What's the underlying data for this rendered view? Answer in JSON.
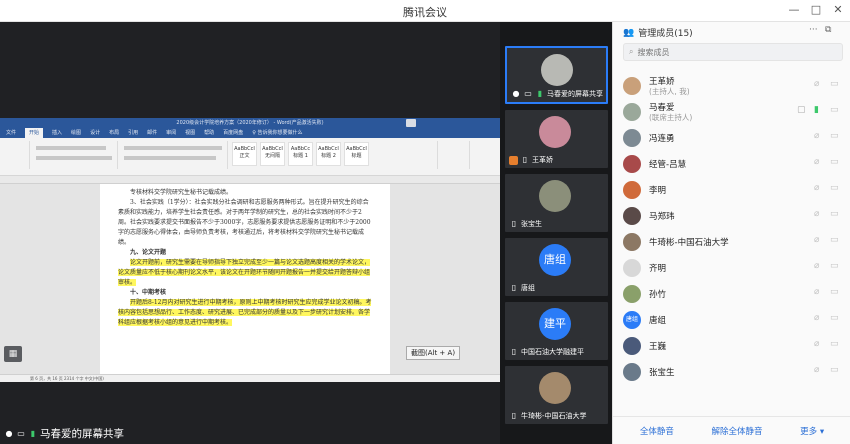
{
  "window": {
    "title": "腾讯会议",
    "controls": [
      "—",
      "□",
      "✕"
    ]
  },
  "shared_screen": {
    "sharer_label": "马春爱的屏幕共享",
    "doc_title": "2020级会计学院培养方案（2020年修订） - Word(产品激活失败)",
    "menu": [
      "文件",
      "开始",
      "插入",
      "绘图",
      "设计",
      "布局",
      "引用",
      "邮件",
      "审阅",
      "视图",
      "帮助",
      "百度网盘",
      "♀ 告诉我你想要做什么"
    ],
    "styles": [
      "AaBbCcI 正文",
      "AaBbCcI 无间隔",
      "AaBbCc 标题 1",
      "AaBbCcI 标题 2",
      "AaBbCcI 标题"
    ],
    "doc": {
      "p1": "专核材料交学院研究生秘书记载成绩。",
      "p2": "3、社会实践（1学分）：社会实践分社会调研和志愿服务两种形式。旨在提升研究生的综合素质和实践能力，培养学生社会责任感。对于两年学制的研究生，总的社会实践时间不少于2周。社会实践要求提交书面报告不少于3000字，志愿服务要求提供志愿服务证明和不少于2000字的志愿服务心得体会，由导师负责考核，考核通过后，将考核材料交学院研究生秘书记载成绩。",
      "h1": "九、论文开题",
      "p3": "论文开题前，研究生需要在导师指导下独立完成至少一篇与论文选题高度相关的学术论文，论文质量应不低于核心期刊论文水平，该论文在开题环节随同开题报告一并提交给开题答辩小组审核。",
      "h2": "十、中期考核",
      "p4": "开题后8-12月内对研究生进行中期考核，原则上中期考核时研究生应完成学业论文初稿。考核内容包括思想品行、工作态度、研究进展、已完成部分的质量以及下一步研究计划安排。各学科组应根据考核小组的意见进行中期考核。"
    },
    "status": "第 6 页，共 16 页   2314 个字   中文(中国)",
    "screenshot_tip": "截图(Alt + A)"
  },
  "videos": [
    {
      "name": "马春爱的屏幕共享",
      "kind": "photo",
      "active": true
    },
    {
      "name": "王革娇",
      "kind": "photo",
      "active": false
    },
    {
      "name": "张宝生",
      "kind": "photo",
      "active": false
    },
    {
      "name": "唐组",
      "kind": "avatar",
      "avatar_text": "唐组",
      "active": false
    },
    {
      "name": "中国石油大学融建平",
      "kind": "avatar",
      "avatar_text": "建平",
      "active": false
    },
    {
      "name": "牛琦彬-中国石油大学",
      "kind": "photo",
      "active": false
    }
  ],
  "panel": {
    "title": "管理成员(15)",
    "search_placeholder": "搜索成员",
    "members": [
      {
        "name": "王革娇",
        "sub": "(主持人, 我)",
        "avatar_color": "#c9a07a"
      },
      {
        "name": "马春爱",
        "sub": "(联席主持人)",
        "avatar_color": "#9aa89a",
        "mic_on": true,
        "screen": true
      },
      {
        "name": "冯连勇",
        "avatar_color": "#7d8a93"
      },
      {
        "name": "经管-吕慧",
        "avatar_color": "#a84a4a"
      },
      {
        "name": "李明",
        "avatar_color": "#d06a3a"
      },
      {
        "name": "马郑玮",
        "avatar_color": "#5a4a48"
      },
      {
        "name": "牛琦彬-中国石油大学",
        "avatar_color": "#8c7864"
      },
      {
        "name": "齐明",
        "avatar_color": "#d8d8d8"
      },
      {
        "name": "孙竹",
        "avatar_color": "#8aa06a"
      },
      {
        "name": "唐组",
        "avatar_color": "#2b7cf7",
        "avatar_text": "唐组"
      },
      {
        "name": "王巍",
        "avatar_color": "#4a5a7a"
      },
      {
        "name": "张宝生",
        "avatar_color": "#6a7a8a"
      }
    ],
    "footer": {
      "mute_all": "全体静音",
      "unmute_all": "解除全体静音",
      "more": "更多 ▾"
    }
  }
}
